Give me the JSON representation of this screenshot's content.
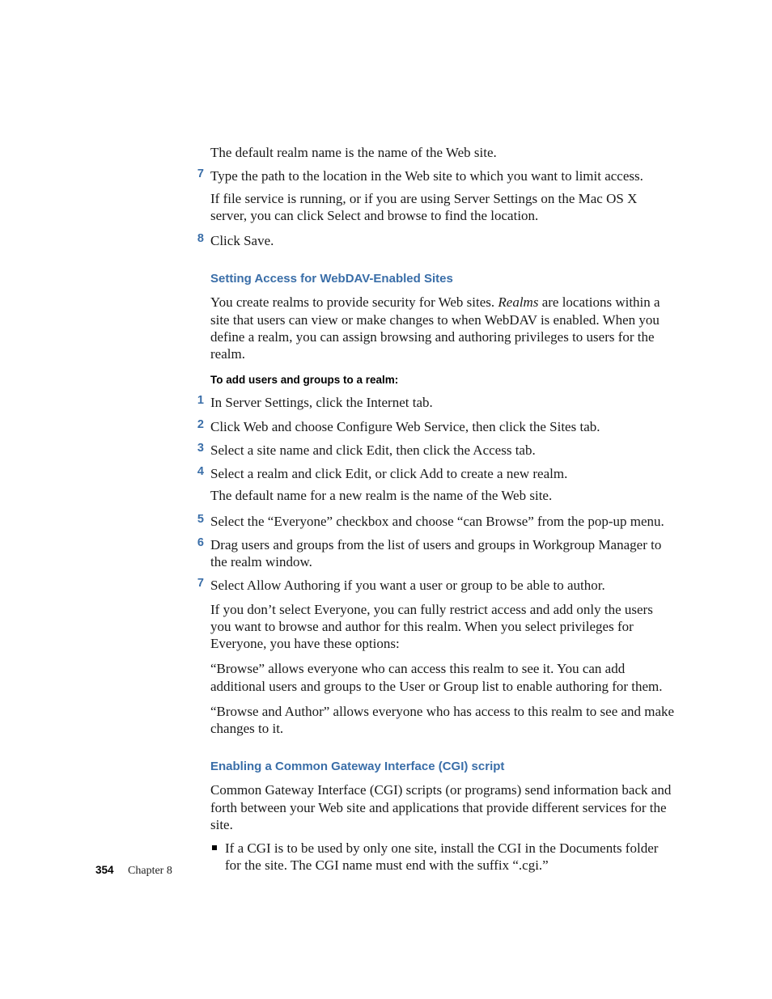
{
  "intro": {
    "p1": "The default realm name is the name of the Web site."
  },
  "topSteps": [
    {
      "num": "7",
      "text": "Type the path to the location in the Web site to which you want to limit access.",
      "after": "If file service is running, or if you are using Server Settings on the Mac OS X server, you can click Select and browse to find the location."
    },
    {
      "num": "8",
      "text": "Click Save."
    }
  ],
  "section1": {
    "heading": "Setting Access for WebDAV-Enabled Sites",
    "p1a": "You create realms to provide security for Web sites. ",
    "p1_em": "Realms",
    "p1b": " are locations within a site that users can view or make changes to when WebDAV is enabled. When you define a realm, you can assign browsing and authoring privileges to users for the realm.",
    "subhead": "To add users and groups to a realm:",
    "steps": [
      {
        "num": "1",
        "text": "In Server Settings, click the Internet tab."
      },
      {
        "num": "2",
        "text": "Click Web and choose Configure Web Service, then click the Sites tab."
      },
      {
        "num": "3",
        "text": "Select a site name and click Edit, then click the Access tab."
      },
      {
        "num": "4",
        "text": "Select a realm and click Edit, or click Add to create a new realm.",
        "after": "The default name for a new realm is the name of the Web site."
      },
      {
        "num": "5",
        "text": "Select the “Everyone” checkbox and choose “can Browse” from the pop-up menu."
      },
      {
        "num": "6",
        "text": "Drag users and groups from the list of users and groups in Workgroup Manager to the realm window."
      },
      {
        "num": "7",
        "text": "Select Allow Authoring if you want a user or group to be able to author."
      }
    ],
    "trailing": [
      "If you don’t select Everyone, you can fully restrict access and add only the users you want to browse and author for this realm. When you select privileges for Everyone, you have these options:",
      "“Browse” allows everyone who can access this realm to see it. You can add additional users and groups to the User or Group list to enable authoring for them.",
      "“Browse and Author” allows everyone who has access to this realm to see and make changes to it."
    ]
  },
  "section2": {
    "heading": "Enabling a Common Gateway Interface (CGI) script",
    "p1": "Common Gateway Interface (CGI) scripts (or programs) send information back and forth between your Web site and applications that provide different services for the site.",
    "bullets": [
      "If a CGI is to be used by only one site, install the CGI in the Documents folder for the site. The CGI name must end with the suffix “.cgi.”"
    ]
  },
  "footer": {
    "page": "354",
    "chapter": "Chapter 8"
  }
}
